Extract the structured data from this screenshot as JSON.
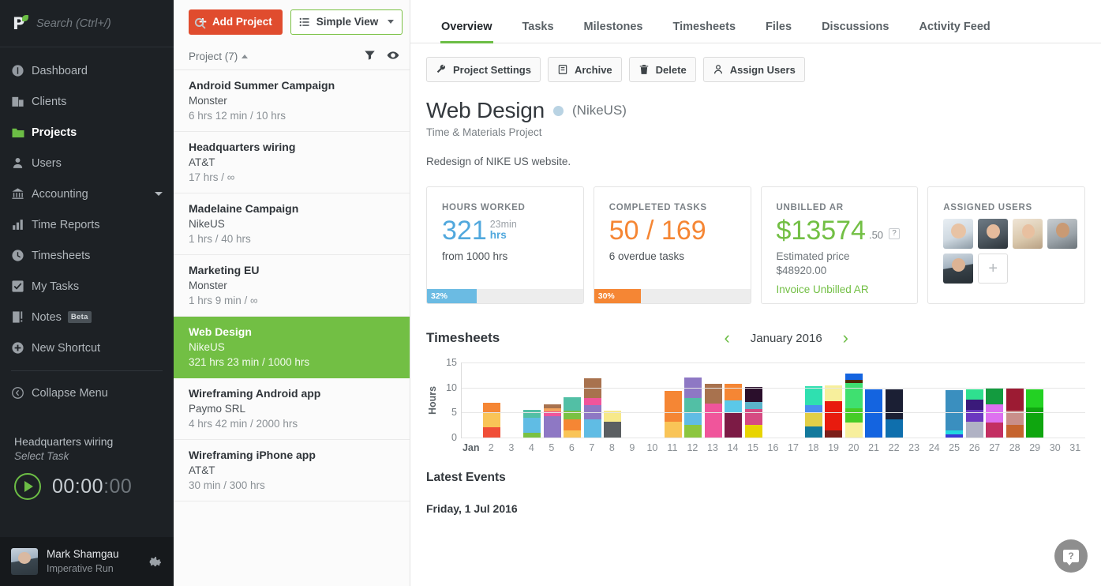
{
  "sidebar": {
    "search": {
      "placeholder": "Search (Ctrl+/)",
      "value": ""
    },
    "items": [
      {
        "label": "Dashboard",
        "icon": "dashboard-icon"
      },
      {
        "label": "Clients",
        "icon": "building-icon"
      },
      {
        "label": "Projects",
        "icon": "folder-icon",
        "active": true
      },
      {
        "label": "Users",
        "icon": "user-icon"
      },
      {
        "label": "Accounting",
        "icon": "bank-icon",
        "caret": true
      },
      {
        "label": "Time Reports",
        "icon": "bar-chart-icon"
      },
      {
        "label": "Timesheets",
        "icon": "clock-icon"
      },
      {
        "label": "My Tasks",
        "icon": "check-icon"
      },
      {
        "label": "Notes",
        "icon": "notes-icon",
        "badge": "Beta"
      },
      {
        "label": "New Shortcut",
        "icon": "plus-circle-icon"
      }
    ],
    "collapse_label": "Collapse Menu",
    "timer": {
      "project": "Headquarters wiring",
      "task": "Select Task",
      "hm": "00:00",
      "seconds": ":00"
    },
    "user": {
      "name": "Mark Shamgau",
      "org": "Imperative Run"
    }
  },
  "projlist": {
    "add_label": "Add Project",
    "view_label": "Simple View",
    "header": "Project (7)",
    "projects": [
      {
        "name": "Android Summer Campaign",
        "client": "Monster",
        "hours": "6 hrs 12 min / 10 hrs"
      },
      {
        "name": "Headquarters wiring",
        "client": "AT&T",
        "hours": "17 hrs / ∞"
      },
      {
        "name": "Madelaine Campaign",
        "client": "NikeUS",
        "hours": "1 hrs / 40 hrs"
      },
      {
        "name": "Marketing EU",
        "client": "Monster",
        "hours": "1 hrs 9 min / ∞"
      },
      {
        "name": "Web Design",
        "client": "NikeUS",
        "hours": "321 hrs 23 min / 1000 hrs",
        "selected": true
      },
      {
        "name": "Wireframing Android app",
        "client": "Paymo SRL",
        "hours": "4 hrs 42 min / 2000 hrs"
      },
      {
        "name": "Wireframing iPhone app",
        "client": "AT&T",
        "hours": "30 min / 300 hrs"
      }
    ]
  },
  "main": {
    "tabs": [
      {
        "label": "Overview",
        "active": true
      },
      {
        "label": "Tasks"
      },
      {
        "label": "Milestones"
      },
      {
        "label": "Timesheets"
      },
      {
        "label": "Files"
      },
      {
        "label": "Discussions"
      },
      {
        "label": "Activity Feed"
      }
    ],
    "actions": [
      {
        "label": "Project Settings",
        "icon": "wrench-icon"
      },
      {
        "label": "Archive",
        "icon": "archive-icon"
      },
      {
        "label": "Delete",
        "icon": "trash-icon"
      },
      {
        "label": "Assign Users",
        "icon": "assign-user-icon"
      }
    ],
    "project": {
      "title": "Web Design",
      "client": "(NikeUS)",
      "type": "Time & Materials Project",
      "description": "Redesign of NIKE US website.",
      "status_color": "#b9d3e3"
    },
    "cards": {
      "hours_worked": {
        "title": "HOURS WORKED",
        "value": "321",
        "minutes": "23min",
        "unit": "hrs",
        "sub": "from 1000 hrs",
        "progress_label": "32%",
        "progress_pct": 32,
        "color": "#51a8dd"
      },
      "completed_tasks": {
        "title": "COMPLETED TASKS",
        "value": "50 / 169",
        "sub": "6 overdue tasks",
        "progress_label": "30%",
        "progress_pct": 30,
        "color": "#f58634"
      },
      "unbilled_ar": {
        "title": "UNBILLED AR",
        "value": "$13574",
        "cents": ".50",
        "help": "?",
        "sub_line1": "Estimated price",
        "sub_line2": "$48920.00",
        "link": "Invoice Unbilled AR",
        "color": "#72bf44"
      },
      "assigned_users": {
        "title": "ASSIGNED USERS",
        "count": 5,
        "add_label": "+"
      }
    },
    "timesheets": {
      "title": "Timesheets",
      "month": "January 2016",
      "prev": "‹",
      "next": "›"
    },
    "events": {
      "title": "Latest Events",
      "date": "Friday, 1 Jul 2016"
    },
    "help_label": "?"
  },
  "chart_data": {
    "type": "bar",
    "stacked": true,
    "title": "Timesheets",
    "xlabel": "",
    "ylabel": "Hours",
    "ylim": [
      0,
      15
    ],
    "yticks": [
      0,
      5,
      10,
      15
    ],
    "grid": true,
    "legend": "none",
    "categories": [
      "Jan",
      "2",
      "3",
      "4",
      "5",
      "6",
      "7",
      "8",
      "9",
      "10",
      "11",
      "12",
      "13",
      "14",
      "15",
      "16",
      "17",
      "18",
      "19",
      "20",
      "21",
      "22",
      "23",
      "24",
      "25",
      "26",
      "27",
      "28",
      "29",
      "30",
      "31"
    ],
    "totals": [
      0,
      7.0,
      0,
      5.6,
      6.6,
      8.1,
      11.8,
      5.4,
      0,
      0,
      9.3,
      12.0,
      10.8,
      10.8,
      10.1,
      0,
      0,
      10.2,
      10.5,
      12.8,
      9.6,
      9.6,
      0,
      0,
      9.4,
      9.6,
      10.0,
      9.8,
      9.6,
      0,
      0
    ],
    "stacks": [
      [],
      [
        {
          "v": 2.0,
          "c": "#f04e37"
        },
        {
          "v": 3.0,
          "c": "#f9c457"
        },
        {
          "v": 2.0,
          "c": "#f58634"
        }
      ],
      [],
      [
        {
          "v": 0.9,
          "c": "#7ac143"
        },
        {
          "v": 3.1,
          "c": "#60bce4"
        },
        {
          "v": 1.6,
          "c": "#52bfa5"
        }
      ],
      [
        {
          "v": 4.3,
          "c": "#8e78c4"
        },
        {
          "v": 0.9,
          "c": "#f0559b"
        },
        {
          "v": 0.6,
          "c": "#f4a45f"
        },
        {
          "v": 0.8,
          "c": "#a8724e"
        }
      ],
      [
        {
          "v": 1.4,
          "c": "#f9c457"
        },
        {
          "v": 2.2,
          "c": "#f58634"
        },
        {
          "v": 1.7,
          "c": "#7ac143"
        },
        {
          "v": 2.8,
          "c": "#52bfa5"
        }
      ],
      [
        {
          "v": 3.6,
          "c": "#60bce4"
        },
        {
          "v": 2.9,
          "c": "#8e78c4"
        },
        {
          "v": 1.4,
          "c": "#f0559b"
        },
        {
          "v": 3.9,
          "c": "#a8724e"
        }
      ],
      [
        {
          "v": 3.1,
          "c": "#5b5f62"
        },
        {
          "v": 2.3,
          "c": "#f7e98a"
        }
      ],
      [],
      [],
      [
        {
          "v": 3.1,
          "c": "#f9c457"
        },
        {
          "v": 6.2,
          "c": "#f58634"
        }
      ],
      [
        {
          "v": 2.6,
          "c": "#8cc63f"
        },
        {
          "v": 2.3,
          "c": "#60bce4"
        },
        {
          "v": 3.0,
          "c": "#52bfa5"
        },
        {
          "v": 4.1,
          "c": "#8e78c4"
        }
      ],
      [
        {
          "v": 6.8,
          "c": "#f0559b"
        },
        {
          "v": 4.0,
          "c": "#a8724e"
        }
      ],
      [
        {
          "v": 4.9,
          "c": "#7c1b45"
        },
        {
          "v": 2.6,
          "c": "#5bc8e8"
        },
        {
          "v": 3.3,
          "c": "#f58634"
        }
      ],
      [
        {
          "v": 2.6,
          "c": "#e8d400"
        },
        {
          "v": 3.1,
          "c": "#d64a82"
        },
        {
          "v": 1.4,
          "c": "#5bb3c9"
        },
        {
          "v": 3.0,
          "c": "#2a0e2b"
        }
      ],
      [],
      [],
      [
        {
          "v": 2.2,
          "c": "#13799c"
        },
        {
          "v": 2.7,
          "c": "#e2cf47"
        },
        {
          "v": 1.5,
          "c": "#4a8ef0"
        },
        {
          "v": 3.8,
          "c": "#2fe0b0"
        }
      ],
      [
        {
          "v": 1.4,
          "c": "#7c1f1a"
        },
        {
          "v": 5.8,
          "c": "#e81b0e"
        },
        {
          "v": 3.3,
          "c": "#f7ef9c"
        }
      ],
      [
        {
          "v": 3.0,
          "c": "#f7ef9c"
        },
        {
          "v": 2.9,
          "c": "#46cc26"
        },
        {
          "v": 5.0,
          "c": "#3fe070"
        },
        {
          "v": 0.6,
          "c": "#4a2a05"
        },
        {
          "v": 1.3,
          "c": "#1464e0"
        }
      ],
      [
        {
          "v": 9.6,
          "c": "#1464e0"
        }
      ],
      [
        {
          "v": 3.7,
          "c": "#0f6fad"
        },
        {
          "v": 5.9,
          "c": "#1b1f34"
        }
      ],
      [],
      [],
      [
        {
          "v": 0.6,
          "c": "#3b3bd6"
        },
        {
          "v": 0.8,
          "c": "#23d6e0"
        },
        {
          "v": 8.0,
          "c": "#3a8fbf"
        }
      ],
      [
        {
          "v": 3.1,
          "c": "#b0b2c4"
        },
        {
          "v": 2.4,
          "c": "#6b37c0"
        },
        {
          "v": 2.1,
          "c": "#3a1a7a"
        },
        {
          "v": 2.0,
          "c": "#2fe08f"
        }
      ],
      [
        {
          "v": 3.0,
          "c": "#c32f62"
        },
        {
          "v": 3.6,
          "c": "#de70f0"
        },
        {
          "v": 3.4,
          "c": "#139b3f"
        }
      ],
      [
        {
          "v": 2.6,
          "c": "#c5642f"
        },
        {
          "v": 2.7,
          "c": "#c98f8a"
        },
        {
          "v": 4.5,
          "c": "#9c1b33"
        }
      ],
      [
        {
          "v": 6.0,
          "c": "#0fa60f"
        },
        {
          "v": 3.6,
          "c": "#23d123"
        }
      ],
      [],
      []
    ]
  }
}
